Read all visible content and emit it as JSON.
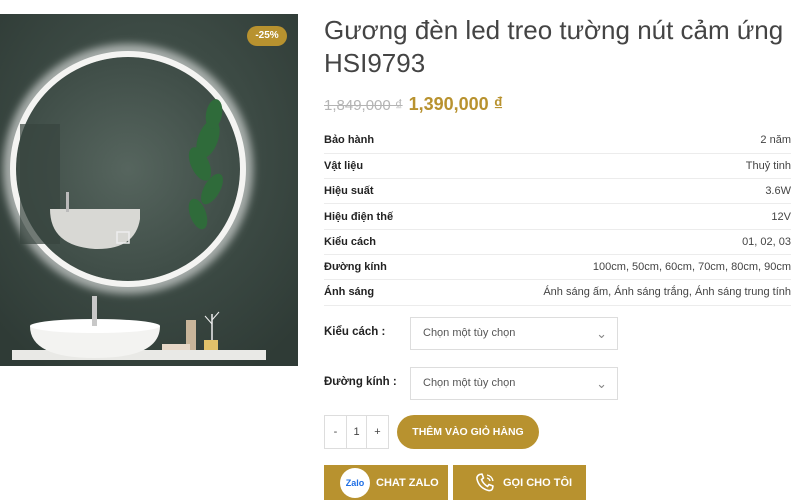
{
  "product": {
    "sale_badge": "-25%",
    "title": "Gương đèn led treo tường nút cảm ứng HSI9793",
    "price_old": "1,849,000 ₫",
    "price_new": "1,390,000 ₫"
  },
  "specs": [
    {
      "label": "Bảo hành",
      "value": "2 năm"
    },
    {
      "label": "Vật liệu",
      "value": "Thuỷ tinh"
    },
    {
      "label": "Hiệu suất",
      "value": "3.6W"
    },
    {
      "label": "Hiệu điện thế",
      "value": "12V"
    },
    {
      "label": "Kiểu cách",
      "value": "01, 02, 03"
    },
    {
      "label": "Đường kính",
      "value": "100cm, 50cm, 60cm, 70cm, 80cm, 90cm"
    },
    {
      "label": "Ánh sáng",
      "value": "Ánh sáng ấm, Ánh sáng trắng, Ánh sáng trung tính"
    }
  ],
  "options": {
    "style_label": "Kiểu cách :",
    "style_value": "Chọn một tùy chọn",
    "diameter_label": "Đường kính :",
    "diameter_value": "Chọn một tùy chọn"
  },
  "cart": {
    "minus": "-",
    "quantity": "1",
    "plus": "+",
    "add_label": "THÊM VÀO GIỎ HÀNG"
  },
  "contact": {
    "zalo_logo": "Zalo",
    "zalo_label": "CHAT ZALO",
    "call_label": "GỌI CHO TÔI"
  },
  "colors": {
    "accent": "#b8922f",
    "wall": "#3d4b45"
  }
}
